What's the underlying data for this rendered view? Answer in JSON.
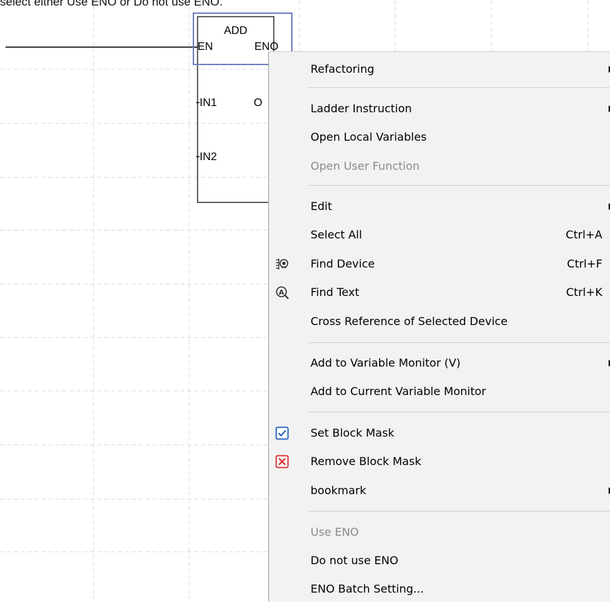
{
  "caption": "select either Use ENO or Do not use ENO.",
  "block": {
    "title": "ADD",
    "en": "EN",
    "eno": "ENO",
    "in1": "IN1",
    "in2": "IN2",
    "out": "O"
  },
  "menu": {
    "refactoring": "Refactoring",
    "ladder_instruction": "Ladder Instruction",
    "open_local_variables": "Open Local Variables",
    "open_user_function": "Open User Function",
    "edit": "Edit",
    "select_all": "Select All",
    "select_all_shortcut": "Ctrl+A",
    "find_device": "Find Device",
    "find_device_shortcut": "Ctrl+F",
    "find_text": "Find Text",
    "find_text_shortcut": "Ctrl+K",
    "cross_reference": "Cross Reference of Selected Device",
    "add_to_variable_monitor": "Add to Variable Monitor (V)",
    "add_to_current_variable_monitor": "Add to Current Variable Monitor",
    "set_block_mask": "Set Block Mask",
    "remove_block_mask": "Remove Block Mask",
    "bookmark": "bookmark",
    "use_eno": "Use ENO",
    "do_not_use_eno": "Do not use ENO",
    "eno_batch_setting": "ENO Batch Setting..."
  },
  "colors": {
    "selection_border": "#6f83c2",
    "checkbox_blue": "#1f5fbf",
    "remove_red": "#d62b2b",
    "grid": "#d7d7e8"
  }
}
